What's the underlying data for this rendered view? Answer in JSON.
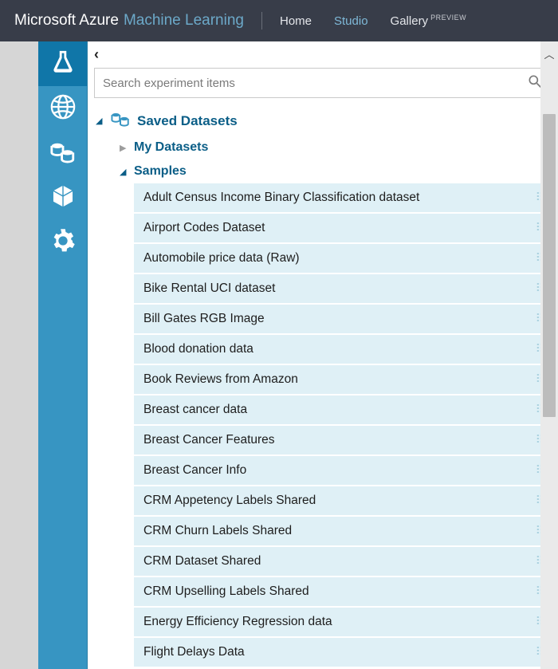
{
  "header": {
    "brand_primary": "Microsoft Azure",
    "brand_secondary": "Machine Learning",
    "nav": [
      {
        "label": "Home",
        "active": false
      },
      {
        "label": "Studio",
        "active": true
      },
      {
        "label": "Gallery",
        "active": false,
        "badge": "PREVIEW"
      }
    ]
  },
  "search": {
    "placeholder": "Search experiment items"
  },
  "tree": {
    "root_label": "Saved Datasets",
    "my_datasets_label": "My Datasets",
    "samples_label": "Samples"
  },
  "samples": [
    "Adult Census Income Binary Classification dataset",
    "Airport Codes Dataset",
    "Automobile price data (Raw)",
    "Bike Rental UCI dataset",
    "Bill Gates RGB Image",
    "Blood donation data",
    "Book Reviews from Amazon",
    "Breast cancer data",
    "Breast Cancer Features",
    "Breast Cancer Info",
    "CRM Appetency Labels Shared",
    "CRM Churn Labels Shared",
    "CRM Dataset Shared",
    "CRM Upselling Labels Shared",
    "Energy Efficiency Regression data",
    "Flight Delays Data"
  ]
}
